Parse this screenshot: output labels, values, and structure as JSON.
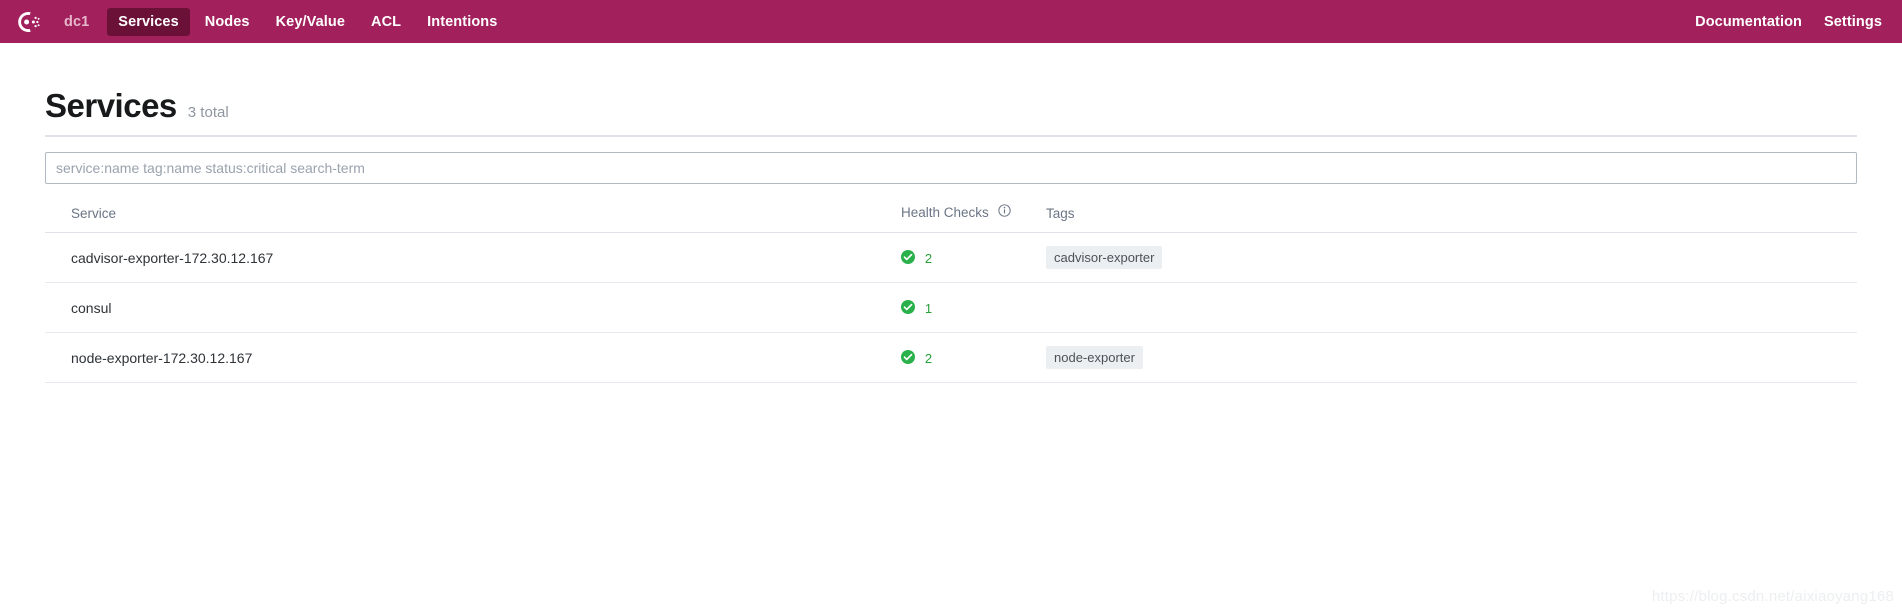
{
  "navbar": {
    "logo_icon": "consul-logo-icon",
    "brand_color": "#a2215c",
    "active_color": "#6b1138",
    "datacenter": "dc1",
    "items": [
      {
        "label": "Services",
        "active": true
      },
      {
        "label": "Nodes",
        "active": false
      },
      {
        "label": "Key/Value",
        "active": false
      },
      {
        "label": "ACL",
        "active": false
      },
      {
        "label": "Intentions",
        "active": false
      }
    ],
    "right_items": [
      {
        "label": "Documentation"
      },
      {
        "label": "Settings"
      }
    ]
  },
  "page": {
    "title": "Services",
    "total": "3 total"
  },
  "search": {
    "value": "",
    "placeholder": "service:name tag:name status:critical search-term"
  },
  "table": {
    "columns": {
      "service": "Service",
      "health_checks": "Health Checks",
      "health_checks_info_icon": "info-icon",
      "tags": "Tags"
    },
    "rows": [
      {
        "service": "cadvisor-exporter-172.30.12.167",
        "status_icon": "check-circle-icon",
        "checks": "2",
        "tag": "cadvisor-exporter"
      },
      {
        "service": "consul",
        "status_icon": "check-circle-icon",
        "checks": "1",
        "tag": ""
      },
      {
        "service": "node-exporter-172.30.12.167",
        "status_icon": "check-circle-icon",
        "checks": "2",
        "tag": "node-exporter"
      }
    ]
  },
  "watermark": {
    "text": "https://blog.csdn.net/aixiaoyang168"
  },
  "colors": {
    "brand": "#a2215c",
    "active_tab": "#6b1138",
    "health_green": "#2ab14b",
    "tag_bg": "#eceff2"
  }
}
